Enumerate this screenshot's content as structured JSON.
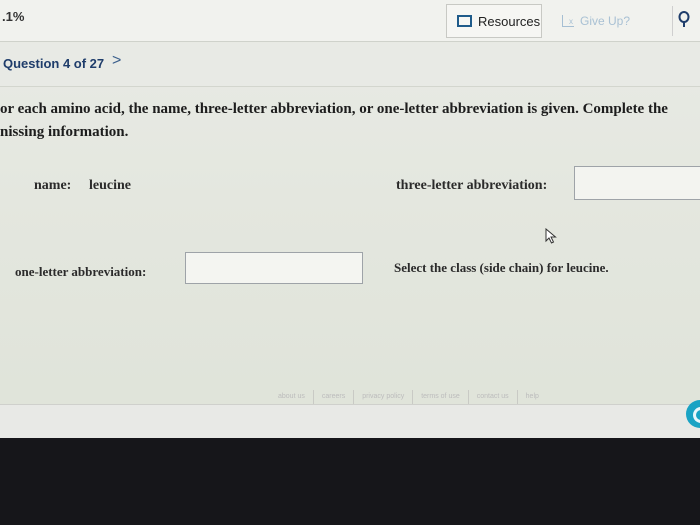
{
  "topbar": {
    "score": ".1%",
    "resources_label": "Resources",
    "give_up_label": "Give Up?"
  },
  "question": {
    "header": "Question 4 of 27",
    "next_symbol": ">",
    "prompt_line1": "or each amino acid, the name, three-letter abbreviation, or one-letter abbreviation is given. Complete the",
    "prompt_line2": "nissing information.",
    "name_label": "name:",
    "name_value": "leucine",
    "three_letter_label": "three-letter abbreviation:",
    "one_letter_label": "one-letter abbreviation:",
    "class_label": "Select the class (side chain) for leucine."
  },
  "footer": {
    "links": [
      "about us",
      "careers",
      "privacy policy",
      "terms of use",
      "contact us",
      "help"
    ]
  },
  "colors": {
    "link_blue": "#1f3d6b",
    "resources_icon": "#1f5b8a",
    "give_up_disabled": "#a9c1d4",
    "help_button": "#1aa3c4"
  }
}
